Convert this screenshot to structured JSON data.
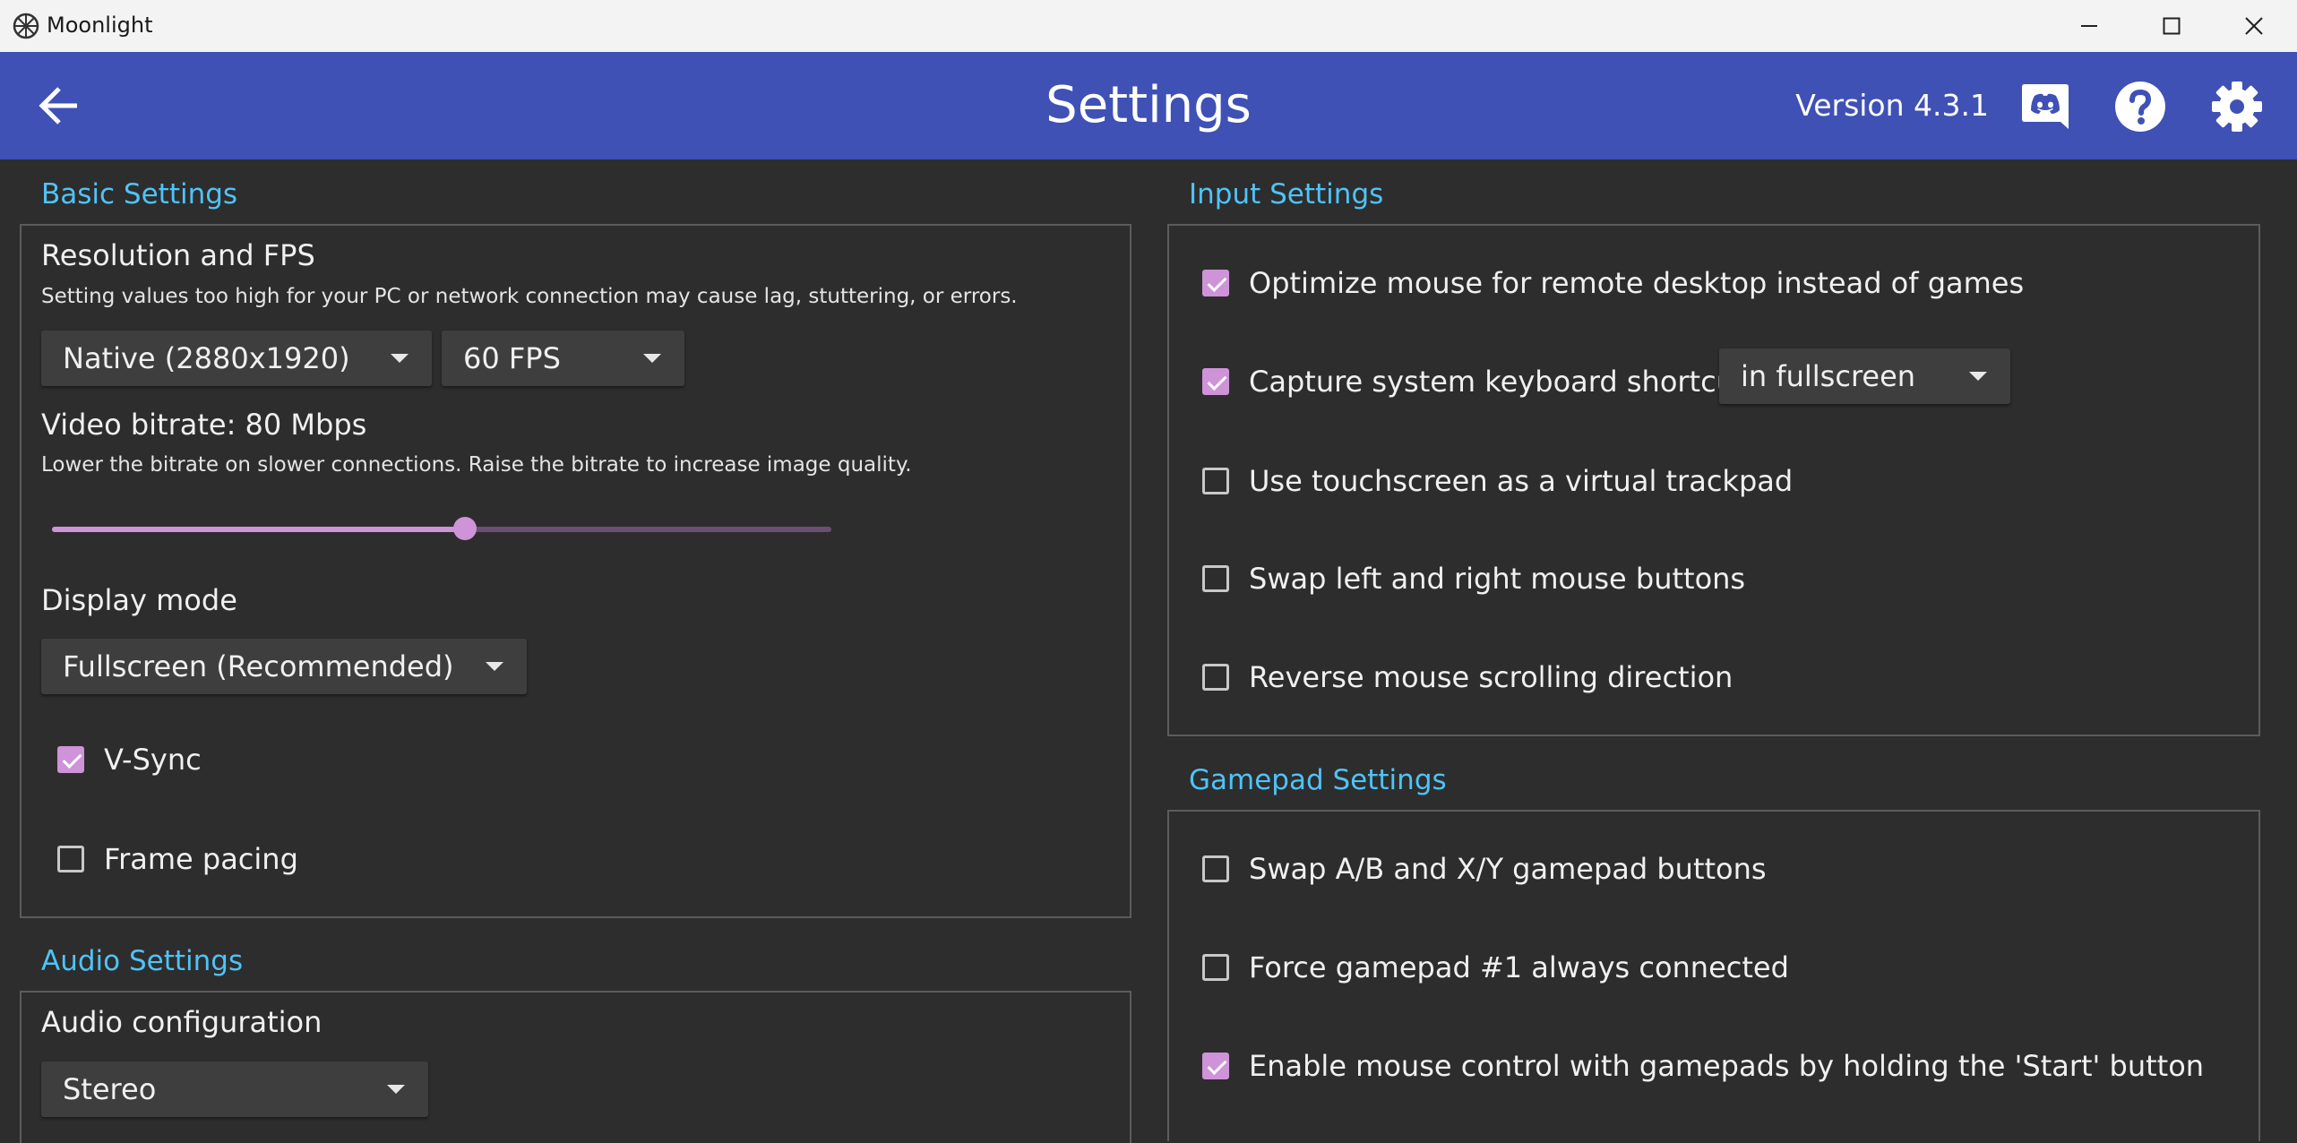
{
  "window": {
    "title": "Moonlight",
    "icons": [
      "moonlight-logo-icon",
      "minimize-icon",
      "maximize-icon",
      "close-icon"
    ]
  },
  "toolbar": {
    "title": "Settings",
    "version": "Version 4.3.1",
    "background": "#3f51b5",
    "icons": [
      "back-arrow-icon",
      "discord-icon",
      "help-icon",
      "gear-icon"
    ]
  },
  "theme": {
    "section_title_color": "#4fc3f7",
    "accent": "#ce93d8",
    "background": "#2d2d2d"
  },
  "basic": {
    "title": "Basic Settings",
    "resolution_label": "Resolution and FPS",
    "resolution_hint": "Setting values too high for your PC or network connection may cause lag, stuttering, or errors.",
    "resolution_value": "Native (2880x1920)",
    "fps_value": "60 FPS",
    "bitrate_label": "Video bitrate: 80 Mbps",
    "bitrate_hint": "Lower the bitrate on slower connections. Raise the bitrate to increase image quality.",
    "bitrate_slider_fraction": 0.53,
    "display_mode_label": "Display mode",
    "display_mode_value": "Fullscreen (Recommended)",
    "vsync_label": "V-Sync",
    "vsync_checked": true,
    "frame_pacing_label": "Frame pacing",
    "frame_pacing_checked": false
  },
  "audio": {
    "title": "Audio Settings",
    "config_label": "Audio configuration",
    "config_value": "Stereo"
  },
  "input": {
    "title": "Input Settings",
    "fullscreen_combo_value": "in fullscreen",
    "items": [
      {
        "label": "Optimize mouse for remote desktop instead of games",
        "checked": true
      },
      {
        "label": "Capture system keyboard shortcuts",
        "checked": true
      },
      {
        "label": "Use touchscreen as a virtual trackpad",
        "checked": false
      },
      {
        "label": "Swap left and right mouse buttons",
        "checked": false
      },
      {
        "label": "Reverse mouse scrolling direction",
        "checked": false
      }
    ]
  },
  "gamepad": {
    "title": "Gamepad Settings",
    "items": [
      {
        "label": "Swap A/B and X/Y gamepad buttons",
        "checked": false
      },
      {
        "label": "Force gamepad #1 always connected",
        "checked": false
      },
      {
        "label": "Enable mouse control with gamepads by holding the 'Start' button",
        "checked": true
      }
    ]
  }
}
